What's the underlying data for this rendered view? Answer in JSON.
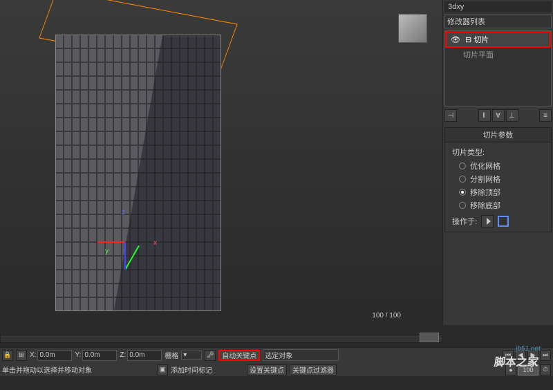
{
  "viewport": {
    "frame_indicator": "100 / 100",
    "gizmo": {
      "x": "x",
      "y": "y",
      "z": "z"
    }
  },
  "panel": {
    "object_name": "3dxy",
    "modifier_list_label": "修改器列表",
    "stack": {
      "active": "切片",
      "sub": "切片平面"
    },
    "tools": [
      "⊣",
      "‖",
      "∀",
      "⊥",
      "≡"
    ],
    "rollout": {
      "title": "切片参数",
      "type_label": "切片类型:",
      "options": [
        "优化网格",
        "分割网格",
        "移除顶部",
        "移除底部"
      ],
      "selected_index": 2,
      "apply_label": "操作于:"
    }
  },
  "status": {
    "coords": {
      "x_label": "X:",
      "x_val": "0.0m",
      "y_label": "Y:",
      "y_val": "0.0m",
      "z_label": "Z:",
      "z_val": "0.0m"
    },
    "grid_label": "栅格",
    "auto_key": "自动关键点",
    "selected_objects": "选定对象",
    "set_key": "设置关键点",
    "key_filters": "关键点过滤器",
    "prompt": "单击并拖动以选择并移动对象",
    "add_time_tag": "添加时间标记",
    "cur_frame": "100",
    "transport": [
      "⏮",
      "◀",
      "▶",
      "⏭",
      "●"
    ]
  },
  "watermark": {
    "url": "jb51.net",
    "site": "脚本之家"
  }
}
